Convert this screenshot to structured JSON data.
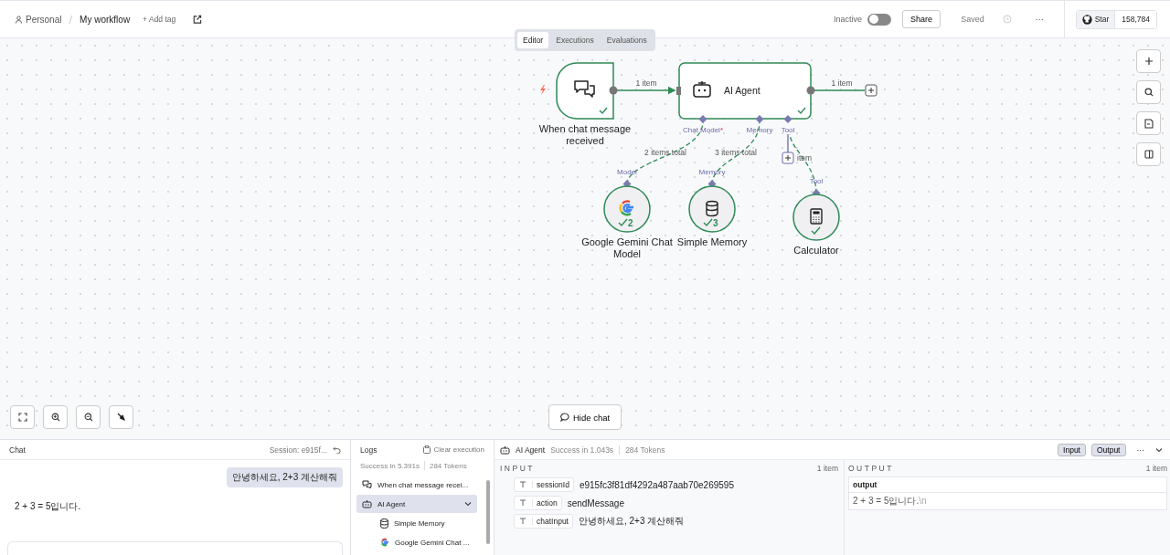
{
  "header": {
    "project": "Personal",
    "separator": "/",
    "workflow": "My workflow",
    "add_tag": "+ Add tag",
    "active_toggle": {
      "label": "Inactive",
      "on": false
    },
    "share": "Share",
    "status": "Saved",
    "more": "···",
    "github": {
      "star": "Star",
      "count": "158,784"
    }
  },
  "view_tabs": [
    {
      "label": "Editor",
      "selected": true
    },
    {
      "label": "Executions",
      "selected": false
    },
    {
      "label": "Evaluations",
      "selected": false
    }
  ],
  "canvas": {
    "nodes": [
      {
        "kind": "trigger",
        "label": "When chat message received",
        "success": true
      },
      {
        "kind": "agent",
        "label": "AI Agent",
        "success": true
      },
      {
        "kind": "model",
        "label": "Google Gemini Chat Model",
        "badge": "2",
        "port": "Model",
        "success": true
      },
      {
        "kind": "memory",
        "label": "Simple Memory",
        "badge": "3",
        "port": "Memory",
        "success": true
      },
      {
        "kind": "tool",
        "label": "Calculator",
        "port": "Tool",
        "success": true
      }
    ],
    "agent_ports": [
      {
        "label": "Chat Model",
        "required": "*"
      },
      {
        "label": "Memory"
      },
      {
        "label": "Tool"
      }
    ],
    "edge_labels": {
      "trigger_to_agent": "1 item",
      "agent_out": "1 item",
      "model": "2 items total",
      "memory": "3 items total",
      "tool": "item"
    },
    "hide_chat": "Hide chat"
  },
  "chat": {
    "title": "Chat",
    "session": "Session: e915f...",
    "messages": [
      {
        "kind": "user",
        "text": "안녕하세요, 2+3 계산해줘"
      },
      {
        "kind": "bot",
        "text": "2 + 3 = 5입니다."
      }
    ]
  },
  "logs": {
    "title": "Logs",
    "clear": "Clear execution",
    "summary": "Success in 5.391s",
    "tokens": "284 Tokens",
    "items": [
      {
        "kind": "chat",
        "label": "When chat message recei...",
        "selected": false
      },
      {
        "kind": "agent",
        "label": "AI Agent",
        "selected": true,
        "expanded": true,
        "children": [
          {
            "kind": "memory",
            "label": "Simple Memory",
            "selected": false
          },
          {
            "kind": "model",
            "label": "Google Gemini Chat ...",
            "selected": false
          }
        ]
      }
    ]
  },
  "detail": {
    "node": "AI Agent",
    "status": "Success in 1.043s",
    "tokens": "284 Tokens",
    "buttons": [
      {
        "label": "Input",
        "selected": true
      },
      {
        "label": "Output",
        "selected": true
      }
    ],
    "more": "···",
    "input": {
      "title": "INPUT",
      "count": "1 item",
      "fields": [
        {
          "name": "sessionId",
          "value": "e915fc3f81df4292a487aab70e269595"
        },
        {
          "name": "action",
          "value": "sendMessage"
        },
        {
          "name": "chatInput",
          "value": "안녕하세요, 2+3 계산해줘"
        }
      ]
    },
    "output": {
      "title": "OUTPUT",
      "count": "1 item",
      "column": "output",
      "value": "2 + 3 = 5입니다.",
      "escape": "\\n"
    }
  }
}
